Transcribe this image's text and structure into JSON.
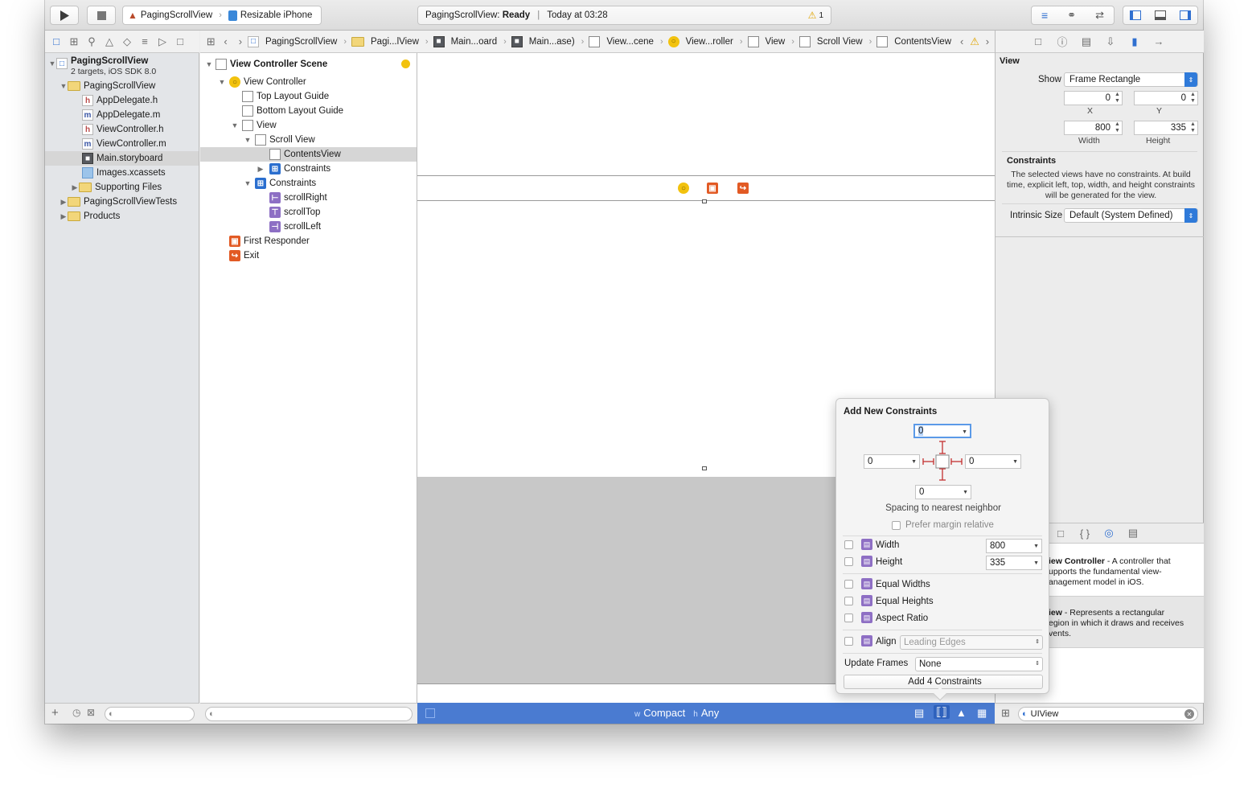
{
  "toolbar": {
    "scheme_project": "PagingScrollView",
    "scheme_device": "Resizable iPhone",
    "status_project": "PagingScrollView:",
    "status_state": "Ready",
    "status_sep": "|",
    "status_time": "Today at 03:28",
    "warning_count": "1"
  },
  "jumpbar": [
    "PagingScrollView",
    "Pagi...lView",
    "Main...oard",
    "Main...ase)",
    "View...cene",
    "View...roller",
    "View",
    "Scroll View",
    "ContentsView"
  ],
  "navigator": {
    "project_name": "PagingScrollView",
    "project_sub": "2 targets, iOS SDK 8.0",
    "group": "PagingScrollView",
    "files": [
      "AppDelegate.h",
      "AppDelegate.m",
      "ViewController.h",
      "ViewController.m",
      "Main.storyboard",
      "Images.xcassets"
    ],
    "subgroup": "Supporting Files",
    "tests": "PagingScrollViewTests",
    "products": "Products"
  },
  "outline": {
    "scene": "View Controller Scene",
    "vc": "View Controller",
    "top_guide": "Top Layout Guide",
    "bottom_guide": "Bottom Layout Guide",
    "view": "View",
    "scroll": "Scroll View",
    "contents": "ContentsView",
    "constraints_inner": "Constraints",
    "constraints": "Constraints",
    "c1": "scrollRight",
    "c2": "scrollTop",
    "c3": "scrollLeft",
    "responder": "First Responder",
    "exit": "Exit"
  },
  "canvas": {
    "size_w": "w",
    "size_w_val": "Compact",
    "size_h": "h",
    "size_h_val": "Any"
  },
  "inspector": {
    "section_view": "View",
    "show_label": "Show",
    "show_value": "Frame Rectangle",
    "x": "0",
    "y": "0",
    "x_label": "X",
    "y_label": "Y",
    "width": "800",
    "height": "335",
    "width_label": "Width",
    "height_label": "Height",
    "constraints_title": "Constraints",
    "constraints_text": "The selected views have no constraints. At build time, explicit left, top, width, and height constraints will be generated for the view.",
    "intrinsic_label": "Intrinsic Size",
    "intrinsic_value": "Default (System Defined)",
    "lib1_title": "iew Controller",
    "lib1_text": " - A controller that",
    "lib1_l2": "upports the fundamental view-",
    "lib1_l3": "anagement model in iOS.",
    "lib2_title": "iew",
    "lib2_text": " - Represents a rectangular",
    "lib2_l2": "egion in which it draws and receives",
    "lib2_l3": "vents.",
    "filter_value": "UIView"
  },
  "popover": {
    "title": "Add New Constraints",
    "top": "0",
    "left": "0",
    "right": "0",
    "bottom": "0",
    "spacing_label": "Spacing to nearest neighbor",
    "margin_label": "Prefer margin relative",
    "width_label": "Width",
    "width_value": "800",
    "height_label": "Height",
    "height_value": "335",
    "eq_widths": "Equal Widths",
    "eq_heights": "Equal Heights",
    "aspect": "Aspect Ratio",
    "align_label": "Align",
    "align_value": "Leading Edges",
    "update_label": "Update Frames",
    "update_value": "None",
    "add_button": "Add 4 Constraints"
  }
}
